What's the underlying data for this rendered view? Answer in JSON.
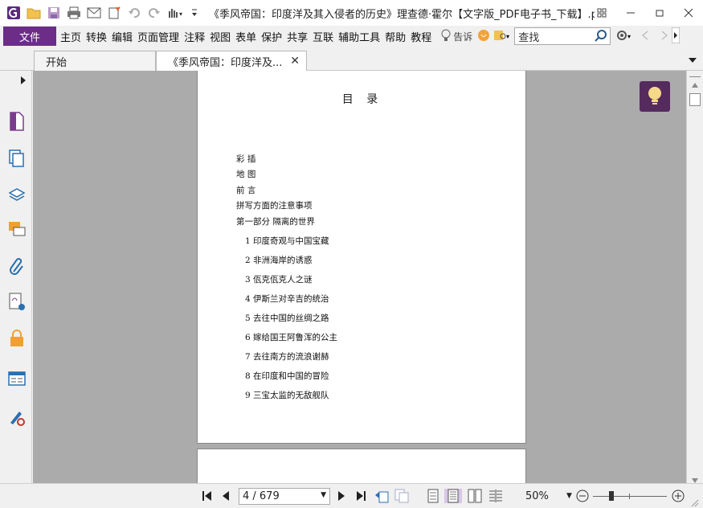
{
  "window": {
    "title": "《季风帝国：印度洋及其入侵者的历史》理查德·霍尔【文字版_PDF电子书_下载】.pdf ..."
  },
  "menu": {
    "file": "文件",
    "items": [
      "主页",
      "转换",
      "编辑",
      "页面管理",
      "注释",
      "视图",
      "表单",
      "保护",
      "共享",
      "互联",
      "辅助工具",
      "帮助",
      "教程"
    ],
    "tell_me": "告诉",
    "search_placeholder": "查找"
  },
  "tabs": [
    {
      "label": "开始",
      "active": false
    },
    {
      "label": "《季风帝国：印度洋及...",
      "active": true,
      "closable": true
    }
  ],
  "document": {
    "toc_title": "目 录",
    "toc_entries": [
      {
        "text": "彩 插"
      },
      {
        "text": "地 图"
      },
      {
        "text": "前 言"
      },
      {
        "text": "拼写方面的注意事项"
      },
      {
        "text": "第一部分 隔离的世界"
      },
      {
        "text": "1 印度奇观与中国宝藏"
      },
      {
        "text": "2 非洲海岸的诱惑"
      },
      {
        "text": "3 佤克佤克人之谜"
      },
      {
        "text": "4 伊斯兰对辛吉的统治"
      },
      {
        "text": "5 去往中国的丝绸之路"
      },
      {
        "text": "6 嫁给国王阿鲁浑的公主"
      },
      {
        "text": "7 去往南方的流浪谢赫"
      },
      {
        "text": "8 在印度和中国的冒险"
      },
      {
        "text": "9 三宝太监的无敌舰队"
      }
    ]
  },
  "statusbar": {
    "page_value": "4 / 679",
    "zoom": "50%"
  },
  "colors": {
    "brand": "#6b2d87",
    "doc_background": "#ababab",
    "tip_button": "#552b5e"
  }
}
